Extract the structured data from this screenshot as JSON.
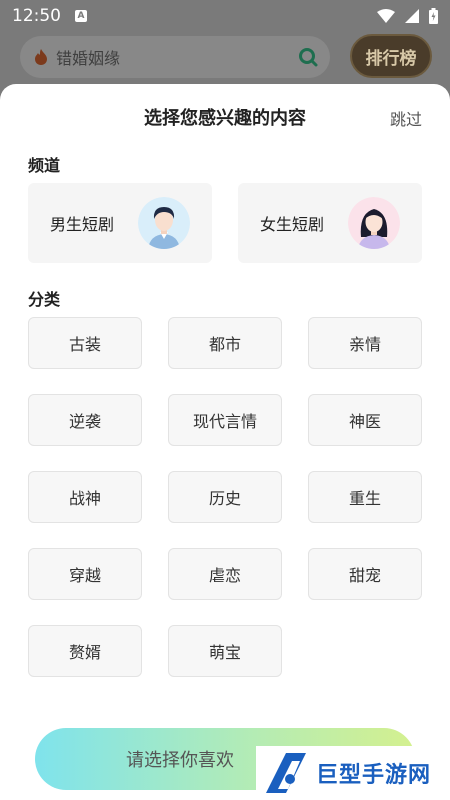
{
  "status_bar": {
    "time": "12:50",
    "indicator": "A"
  },
  "header": {
    "search_text": "错婚姻缘",
    "rank_label": "排行榜"
  },
  "sheet": {
    "title": "选择您感兴趣的内容",
    "skip": "跳过",
    "channel_heading": "频道",
    "channels": [
      {
        "label": "男生短剧",
        "avatar": "male-avatar-icon"
      },
      {
        "label": "女生短剧",
        "avatar": "female-avatar-icon"
      }
    ],
    "category_heading": "分类",
    "categories": [
      "古装",
      "都市",
      "亲情",
      "逆袭",
      "现代言情",
      "神医",
      "战神",
      "历史",
      "重生",
      "穿越",
      "虐恋",
      "甜宠",
      "赘婿",
      "萌宝"
    ],
    "confirm_label": "请选择你喜欢"
  },
  "watermark": {
    "text": "巨型手游网"
  },
  "colors": {
    "accent_start": "#7fe3ec",
    "accent_end": "#d4f08f",
    "scrim": "#7a7a7a"
  }
}
